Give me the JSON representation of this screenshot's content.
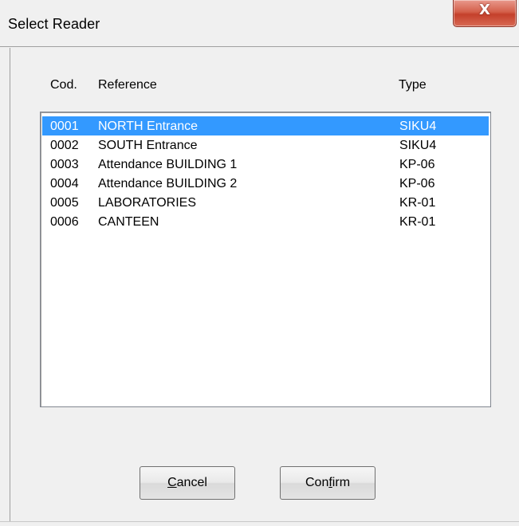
{
  "window": {
    "title": "Select Reader",
    "close_label": "X"
  },
  "columns": {
    "cod": "Cod.",
    "reference": "Reference",
    "type": "Type"
  },
  "readers": [
    {
      "cod": "0001",
      "reference": "NORTH Entrance",
      "type": "SIKU4",
      "selected": true
    },
    {
      "cod": "0002",
      "reference": "SOUTH Entrance",
      "type": "SIKU4",
      "selected": false
    },
    {
      "cod": "0003",
      "reference": "Attendance BUILDING 1",
      "type": "KP-06",
      "selected": false
    },
    {
      "cod": "0004",
      "reference": "Attendance BUILDING 2",
      "type": "KP-06",
      "selected": false
    },
    {
      "cod": "0005",
      "reference": "LABORATORIES",
      "type": "KR-01",
      "selected": false
    },
    {
      "cod": "0006",
      "reference": "CANTEEN",
      "type": "KR-01",
      "selected": false
    }
  ],
  "buttons": {
    "cancel": {
      "label": "Cancel",
      "mnemonic_index": 0
    },
    "confirm": {
      "label": "Confirm",
      "mnemonic_index": 3
    }
  },
  "colors": {
    "selection": "#3399ff",
    "close_button": "#c4402b"
  }
}
